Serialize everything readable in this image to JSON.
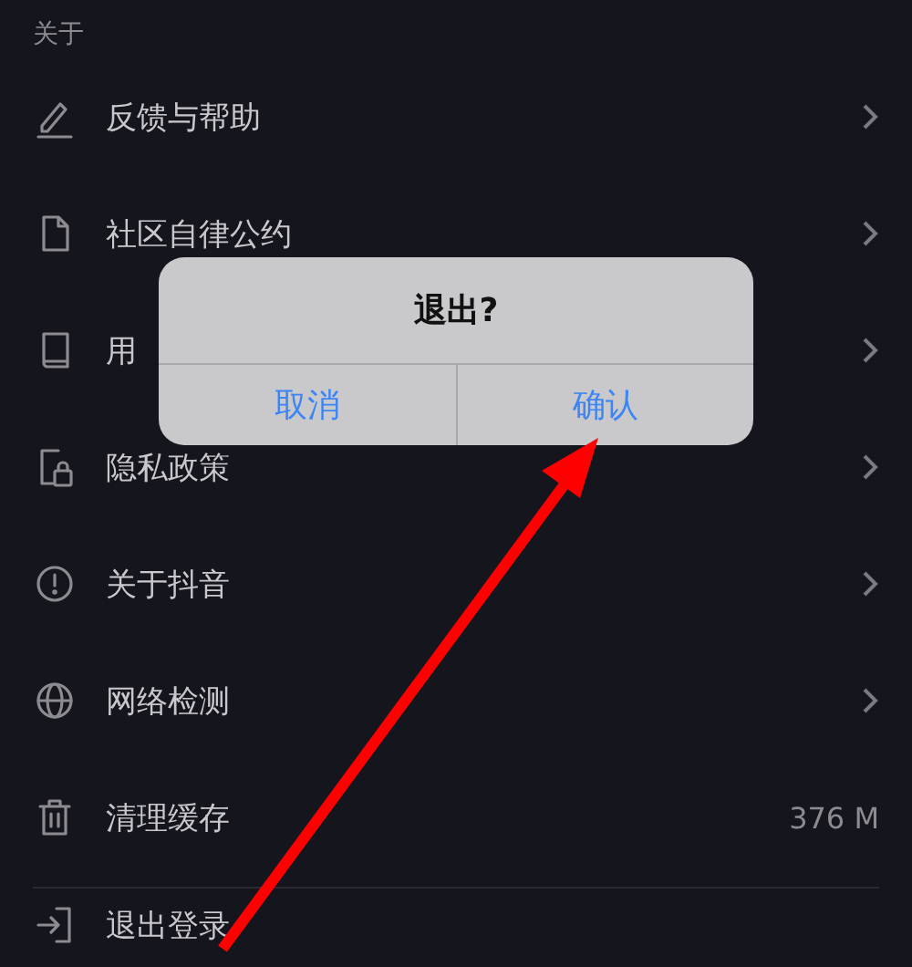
{
  "section_header": "关于",
  "items": [
    {
      "label": "反馈与帮助",
      "kind": "chevron"
    },
    {
      "label": "社区自律公约",
      "kind": "chevron"
    },
    {
      "label": "用",
      "kind": "chevron"
    },
    {
      "label": "隐私政策",
      "kind": "chevron"
    },
    {
      "label": "关于抖音",
      "kind": "chevron"
    },
    {
      "label": "网络检测",
      "kind": "chevron"
    },
    {
      "label": "清理缓存",
      "kind": "value",
      "value": "376 M"
    }
  ],
  "logout": {
    "label": "退出登录"
  },
  "dialog": {
    "title": "退出?",
    "buttons": [
      "取消",
      "确认"
    ]
  }
}
